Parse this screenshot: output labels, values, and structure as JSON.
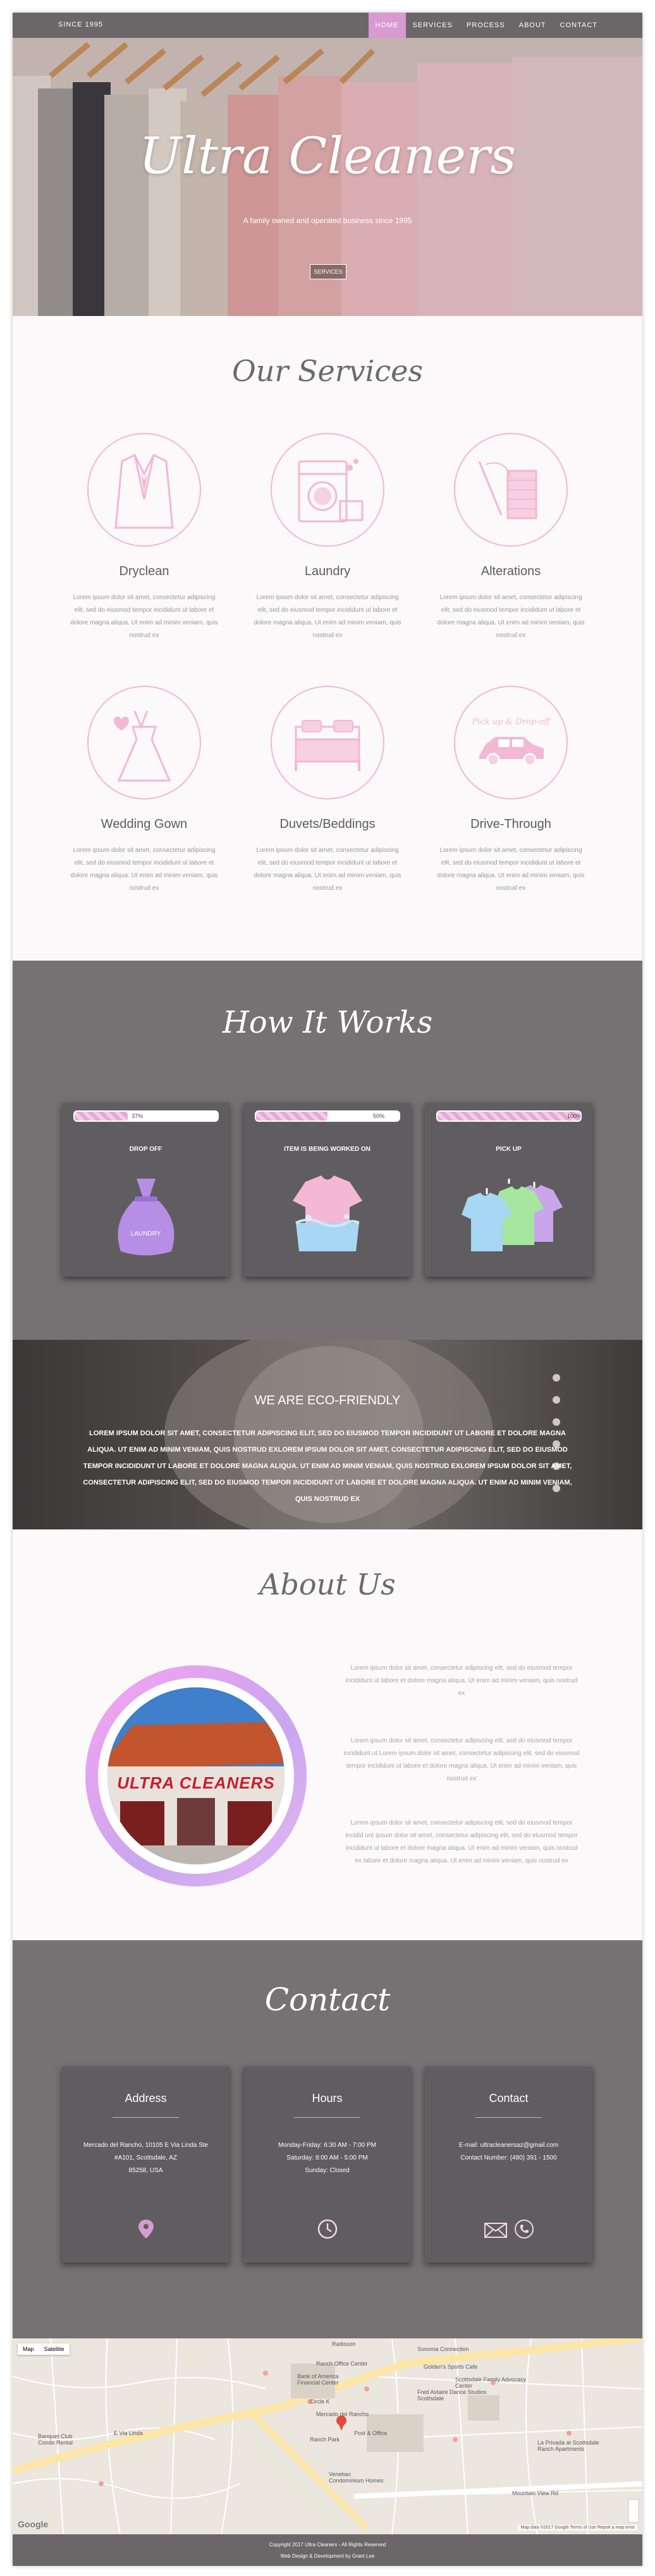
{
  "nav": {
    "brand": "SINCE 1995",
    "links": [
      "HOME",
      "SERVICES",
      "PROCESS",
      "ABOUT",
      "CONTACT"
    ],
    "active": "HOME"
  },
  "hero": {
    "title": "Ultra Cleaners",
    "tagline": "A family owned and operated business since 1995",
    "button": "SERVICES"
  },
  "services": {
    "title": "Our Services",
    "items": [
      {
        "name": "Dryclean",
        "icon": "suit-icon",
        "desc": "Lorem ipsum dolor sit amet, consectetur adipiscing elit, sed do eiusmod tempor incididunt ut labore et dolore magna aliqua. Ut enim ad minim veniam, quis nostrud ex"
      },
      {
        "name": "Laundry",
        "icon": "washing-machine-icon",
        "desc": "Lorem ipsum dolor sit amet, consectetur adipiscing elit, sed do eiusmod tempor incididunt ut labore et dolore magna aliqua. Ut enim ad minim veniam, quis nostrud ex"
      },
      {
        "name": "Alterations",
        "icon": "thread-needle-icon",
        "desc": "Lorem ipsum dolor sit amet, consectetur adipiscing elit, sed do eiusmod tempor incididunt ut labore et dolore magna aliqua. Ut enim ad minim veniam, quis nostrud ex"
      },
      {
        "name": "Wedding Gown",
        "icon": "wedding-gown-icon",
        "desc": "Lorem ipsum dolor sit amet, consectetur adipiscing elit, sed do eiusmod tempor incididunt ut labore et dolore magna aliqua. Ut enim ad minim veniam, quis nostrud ex"
      },
      {
        "name": "Duvets/Beddings",
        "icon": "bed-icon",
        "desc": "Lorem ipsum dolor sit amet, consectetur adipiscing elit, sed do eiusmod tempor incididunt ut labore et dolore magna aliqua. Ut enim ad minim veniam, quis nostrud ex"
      },
      {
        "name": "Drive-Through",
        "icon": "car-icon",
        "desc": "Lorem ipsum dolor sit amet, consectetur adipiscing elit, sed do eiusmod tempor incididunt ut labore et dolore magna aliqua. Ut enim ad minim veniam, quis nostrud ex"
      }
    ],
    "car_caption": "Pick up & Drop-off"
  },
  "how": {
    "title": "How It Works",
    "steps": [
      {
        "title": "DROP OFF",
        "progress_label": "37%",
        "progress": 0.37,
        "icon": "laundry-bag-icon",
        "bag_text": "LAUNDRY"
      },
      {
        "title": "ITEM IS BEING WORKED ON",
        "progress_label": "50%",
        "progress": 0.5,
        "icon": "washing-shirt-icon"
      },
      {
        "title": "PICK UP",
        "progress_label": "100%",
        "progress": 1.0,
        "icon": "hanging-shirts-icon"
      }
    ]
  },
  "eco": {
    "title": "WE ARE ECO-FRIENDLY",
    "text": "LOREM IPSUM DOLOR SIT AMET, CONSECTETUR ADIPISCING ELIT, SED DO EIUSMOD TEMPOR INCIDIDUNT UT LABORE ET DOLORE MAGNA ALIQUA. UT ENIM AD MINIM VENIAM, QUIS NOSTRUD EXLOREM IPSUM DOLOR SIT AMET, CONSECTETUR ADIPISCING ELIT, SED DO EIUSMOD TEMPOR INCIDIDUNT UT LABORE ET DOLORE MAGNA ALIQUA. UT ENIM AD MINIM VENIAM, QUIS NOSTRUD EXLOREM IPSUM DOLOR SIT AMET, CONSECTETUR ADIPISCING ELIT, SED DO EIUSMOD TEMPOR INCIDIDUNT UT LABORE ET DOLORE MAGNA ALIQUA. UT ENIM AD MINIM VENIAM, QUIS NOSTRUD EX"
  },
  "about": {
    "title": "About Us",
    "sign_text": "ULTRA CLEANERS",
    "paragraphs": [
      "Lorem ipsum dolor sit amet, consectetur adipiscing elit, sed do eiusmod tempor incididunt ut labore et dolore magna aliqua. Ut enim ad minim veniam, quis nostrud ex",
      "Lorem ipsum dolor sit amet, consectetur adipiscing elit, sed do eiusmod tempor incididunt ut Lorem ipsum dolor sit amet, consectetur adipiscing elit, sed do eiusmod tempor incididunt ut labore et dolore magna aliqua. Ut enim ad minim veniam, quis nostrud ex",
      "Lorem ipsum dolor sit amet, consectetur adipiscing elit, sed do eiusmod tempor incidid unt ipsum dolor sit amet, consectetur adipiscing elit, sed do eiusmod tempor incididunt ut labore et dolore magna aliqua. Ut enim ad minim veniam, quis nostrud ex labore et dolore magna aliqua. Ut enim ad minim veniam, quis nostrud ex"
    ]
  },
  "contact": {
    "title": "Contact",
    "cards": [
      {
        "heading": "Address",
        "lines": [
          "Mercado del Rancho, 10105 E Via Linda Ste",
          "#A101, Scottsdale, AZ",
          "85258, USA"
        ],
        "icons": [
          "location-pin-icon"
        ]
      },
      {
        "heading": "Hours",
        "lines": [
          "Monday-Friday: 6:30 AM - 7:00 PM",
          "Saturday: 8:00 AM - 5:00 PM",
          "Sunday: Closed"
        ],
        "icons": [
          "clock-icon"
        ]
      },
      {
        "heading": "Contact",
        "lines": [
          "E-mail: ultracleanersaz@gmail.com",
          "Contact Number: (480) 391 - 1500"
        ],
        "icons": [
          "email-icon",
          "phone-icon"
        ]
      }
    ]
  },
  "map": {
    "type_options": [
      "Map",
      "Satellite"
    ],
    "labels": [
      "Radisson",
      "Mercado del Rancho",
      "Ranch Office Center",
      "Bank of America Financial Center",
      "Circle K",
      "Post & Office",
      "Ranch Park",
      "Banquet Club Condo Rental",
      "Scottsdale Family Advocacy Center",
      "Golden's Sports Cafe",
      "Sonoma Connection",
      "Fred Astaire Dance Studios Scottsdale",
      "La Privada at Scottsdale Ranch Apartments",
      "Venetian Condominium Homes",
      "Mountain View Rd",
      "E Via Linda"
    ],
    "attribution": "Map data ©2017 Google   Terms of Use   Report a map error",
    "google": "Google"
  },
  "footer": {
    "copyright": "Copyright 2017 Ultra Cleaners - All Rights Reserved",
    "credit": "Web Design & Development by Grant Lee"
  },
  "colors": {
    "accent": "#d89ad0",
    "dark": "#767274",
    "card": "#5f5d5f",
    "pink": "#f2b8d4"
  }
}
